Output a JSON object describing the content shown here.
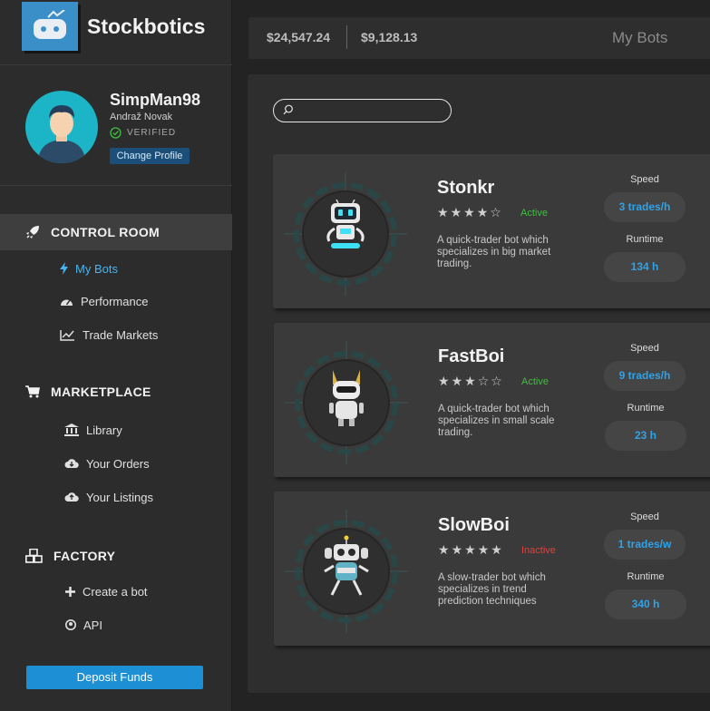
{
  "app": {
    "name": "Stockbotics"
  },
  "profile": {
    "username": "SimpMan98",
    "real_name": "Andraž Novak",
    "verified_label": "VERIFIED",
    "change_profile_label": "Change Profile"
  },
  "sidebar": {
    "control_room": {
      "label": "CONTROL ROOM",
      "items": [
        {
          "label": "My Bots",
          "icon": "bolt-icon"
        },
        {
          "label": "Performance",
          "icon": "gauge-icon"
        },
        {
          "label": "Trade Markets",
          "icon": "line-chart-icon"
        }
      ]
    },
    "marketplace": {
      "label": "MARKETPLACE",
      "items": [
        {
          "label": "Library",
          "icon": "bank-icon"
        },
        {
          "label": "Your Orders",
          "icon": "cloud-download-icon"
        },
        {
          "label": "Your Listings",
          "icon": "cloud-upload-icon"
        }
      ]
    },
    "factory": {
      "label": "FACTORY",
      "items": [
        {
          "label": "Create a bot",
          "icon": "plus-icon"
        },
        {
          "label": "API",
          "icon": "github-icon"
        }
      ]
    },
    "deposit_label": "Deposit Funds"
  },
  "header": {
    "balance_1": "$24,547.24",
    "balance_2": "$9,128.13",
    "page_title": "My Bots"
  },
  "search": {
    "placeholder": ""
  },
  "bots": [
    {
      "name": "Stonkr",
      "rating": 4,
      "status": "Active",
      "description": "A quick-trader bot which specializes in big market trading.",
      "speed_label": "Speed",
      "speed": "3 trades/h",
      "runtime_label": "Runtime",
      "runtime": "134 h"
    },
    {
      "name": "FastBoi",
      "rating": 3,
      "status": "Active",
      "description": "A quick-trader bot which specializes in small scale trading.",
      "speed_label": "Speed",
      "speed": "9 trades/h",
      "runtime_label": "Runtime",
      "runtime": "23 h"
    },
    {
      "name": "SlowBoi",
      "rating": 5,
      "status": "Inactive",
      "description": "A slow-trader bot which specializes in trend prediction techniques",
      "speed_label": "Speed",
      "speed": "1 trades/w",
      "runtime_label": "Runtime",
      "runtime": "340 h"
    }
  ],
  "colors": {
    "accent": "#1d8fd4",
    "active": "#3fbf3f",
    "inactive": "#e0403a",
    "avatar_bg": "#1bb5c7"
  }
}
